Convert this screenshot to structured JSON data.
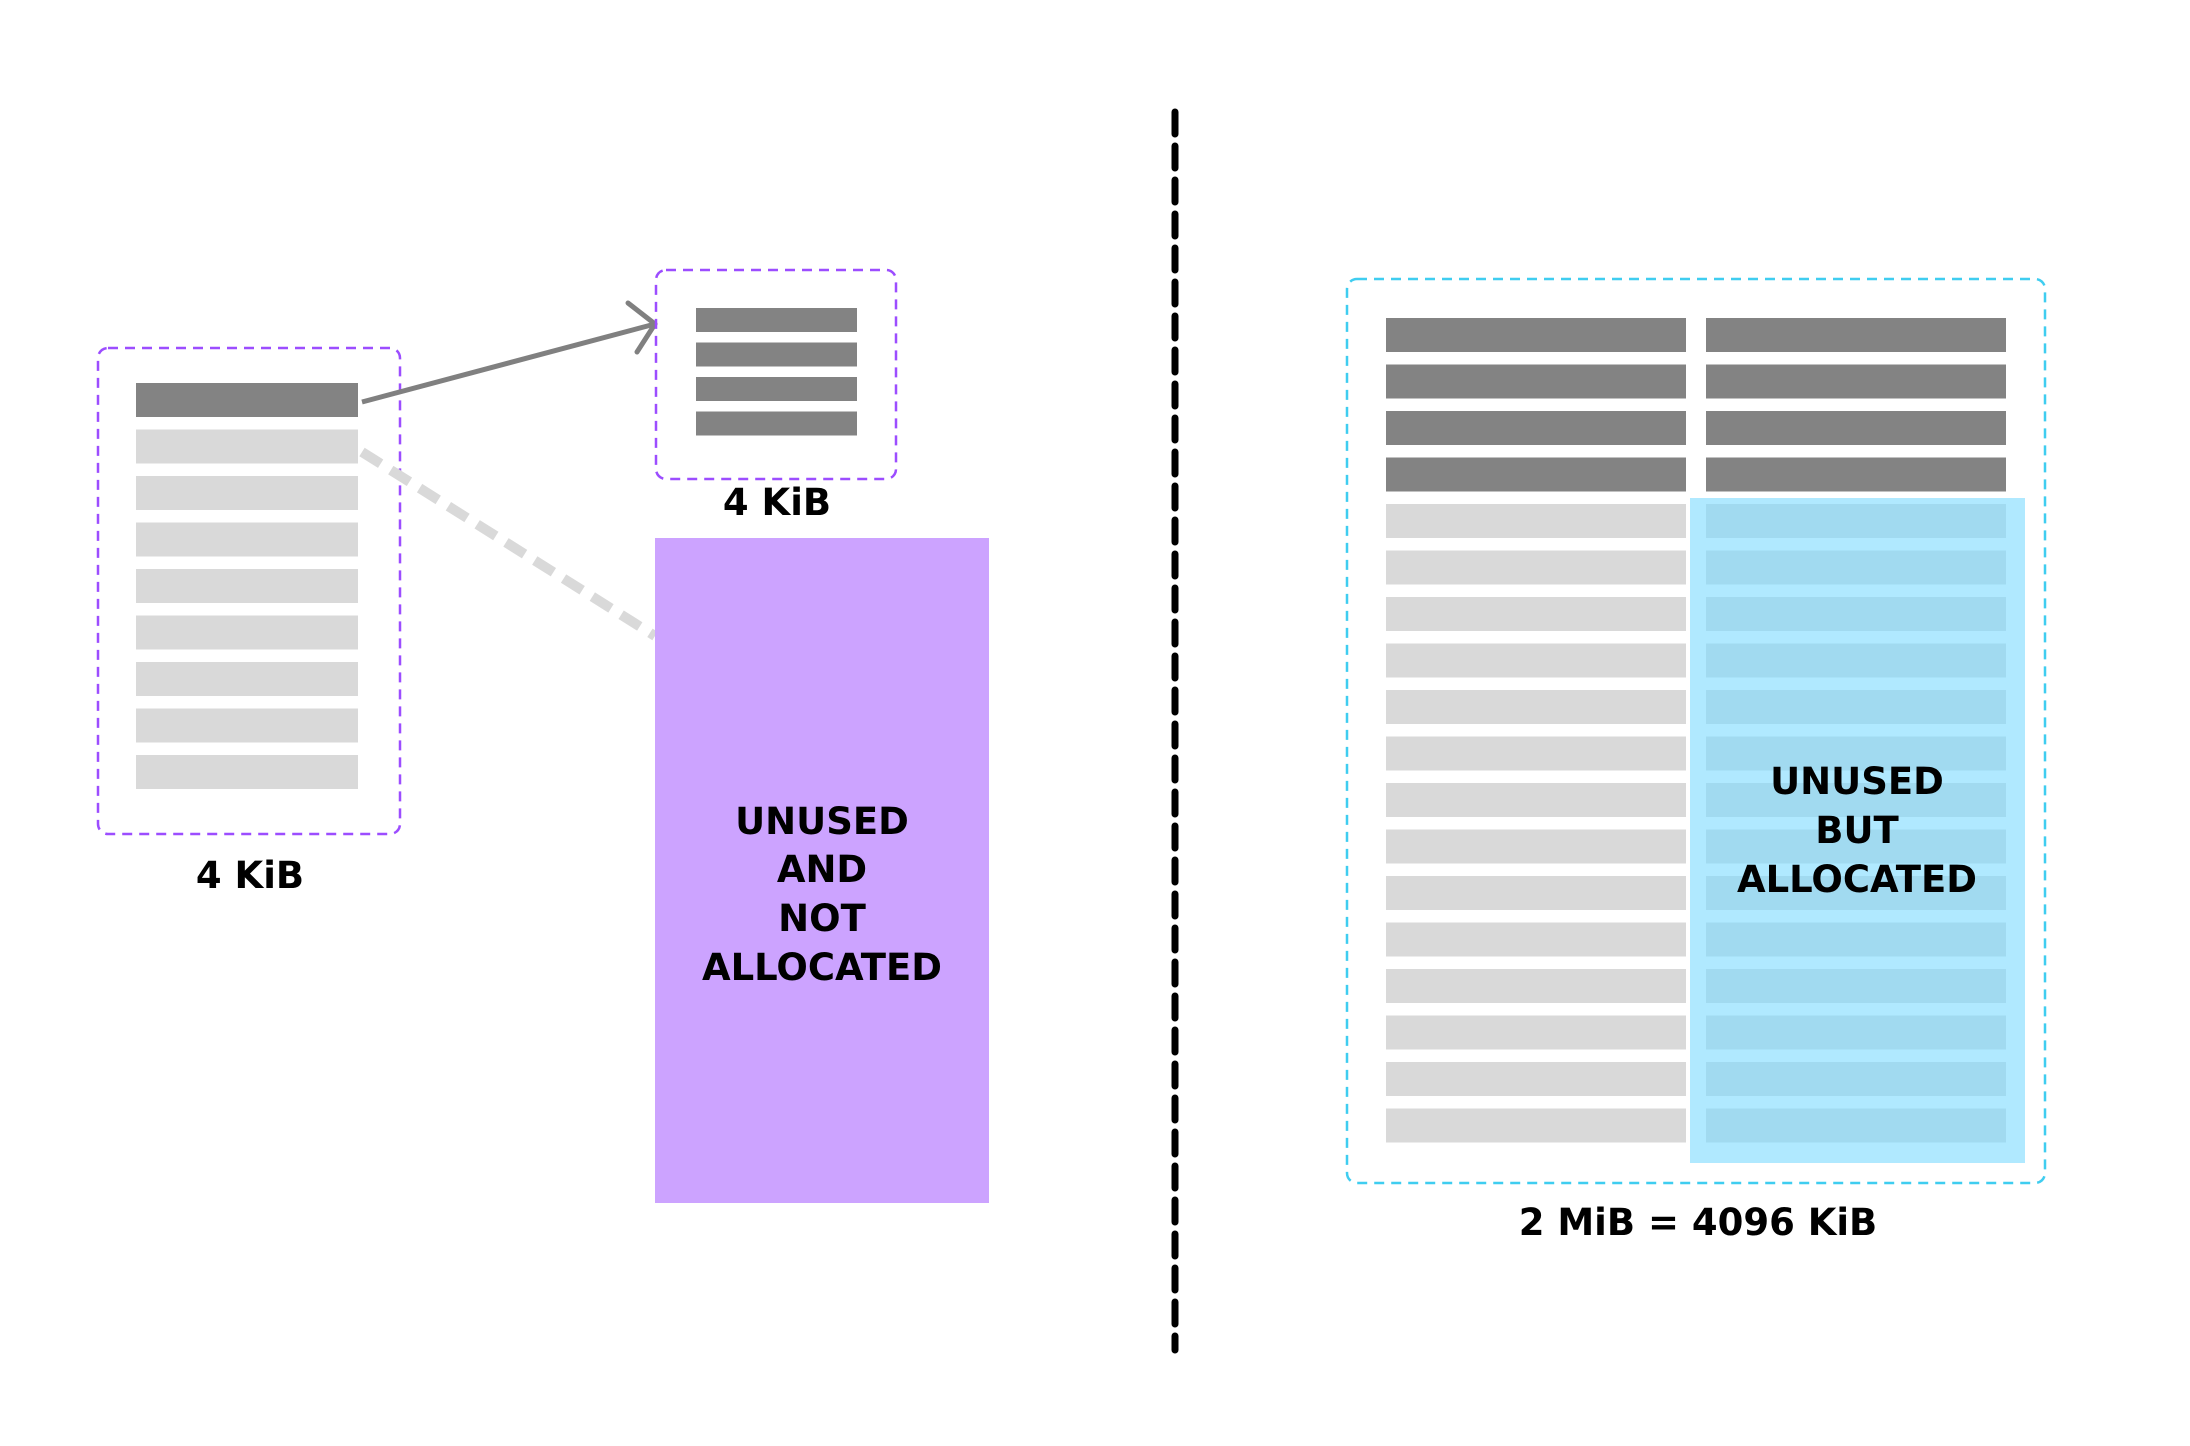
{
  "colors": {
    "background": "#ffffff",
    "row_used": "#838383",
    "row_unused": "#d9d9d9",
    "small_page_border": "#9c4dff",
    "unallocated_block": "#cca3ff",
    "huge_page_border": "#3fcdf0",
    "allocated_overlay": "#7cdbff",
    "divider": "#000000",
    "arrow": "#808080",
    "dashed_pointer": "#d9d9d9"
  },
  "left": {
    "page_table_label": "4 KiB",
    "mapped_page_label": "4 KiB",
    "unallocated": {
      "lines": [
        "UNUSED",
        "AND",
        "NOT",
        "ALLOCATED"
      ]
    },
    "page_table_rows": 9,
    "page_table_used_rows": 1,
    "mapped_page_rows": 4
  },
  "right": {
    "huge_page_label": "2 MiB = 4096 KiB",
    "allocated_unused": {
      "lines": [
        "UNUSED",
        "BUT",
        "ALLOCATED"
      ]
    },
    "columns": 2,
    "rows_per_column": 18,
    "used_rows": 4
  }
}
